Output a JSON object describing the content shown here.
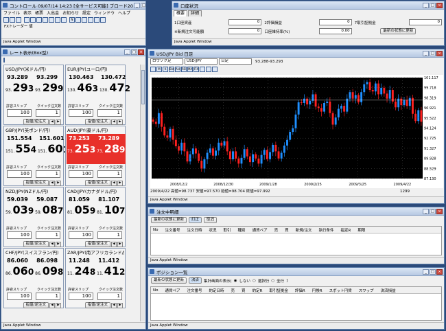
{
  "control": {
    "title": "コントロール 09/07/14 14:23 [全サービス可能] ブロード20",
    "menu": [
      "ファイル",
      "表示",
      "帳票",
      "入出金",
      "お知らせ",
      "設定",
      "ウィンドウ",
      "ヘルプ"
    ],
    "sub": "FXトレーダー 値",
    "status": "Java Applet Window"
  },
  "account": {
    "title": "口座状況",
    "tabs": [
      "概要",
      "詳細"
    ],
    "fields": [
      {
        "label": "1口座資産",
        "value": "0"
      },
      {
        "label": "2評価損益",
        "value": "0"
      },
      {
        "label": "7取引証拠金",
        "value": "0"
      },
      {
        "label": "※新規注文可能額",
        "value": "0"
      },
      {
        "label": "口座維持率(%)",
        "value": "0.00"
      }
    ],
    "refresh": "最新の状態に更新",
    "status": "Java Applet Window"
  },
  "rate": {
    "title": "レート表示(Box型)",
    "allowance_label": "許容スリップ",
    "qty_label": "クイック注文数",
    "order_btn": "指値/逆注文",
    "status": "Java Applet Window",
    "pairs": [
      {
        "name": "USD/JPY(米ドル/円)",
        "bid_small": "93.289",
        "ask_small": "93.299",
        "bid_pre": "93.",
        "bid_big": "29",
        "bid_tail": "3",
        "ask_pre": "93.",
        "ask_big": "29",
        "ask_tail": "9",
        "slip": "100",
        "qty": "1",
        "hl": false
      },
      {
        "name": "EUR/JPY(ユーロ/円)",
        "bid_small": "130.463",
        "ask_small": "130.472",
        "bid_pre": "130.",
        "bid_big": "46",
        "bid_tail": "3",
        "ask_pre": "130.",
        "ask_big": "47",
        "ask_tail": "2",
        "slip": "100",
        "qty": "1",
        "hl": false
      },
      {
        "name": "GBP/JPY(英ポンド/円)",
        "bid_small": "151.554",
        "ask_small": "151.601",
        "bid_pre": "151.",
        "bid_big": "55",
        "bid_tail": "4",
        "ask_pre": "151.",
        "ask_big": "60",
        "ask_tail": "1",
        "slip": "100",
        "qty": "1",
        "hl": false
      },
      {
        "name": "AUD/JPY(豪ドル/円)",
        "bid_small": "73.253",
        "ask_small": "73.289",
        "bid_pre": "73.",
        "bid_big": "25",
        "bid_tail": "3",
        "ask_pre": "73.",
        "ask_big": "28",
        "ask_tail": "9",
        "slip": "100",
        "qty": "1",
        "hl": true
      },
      {
        "name": "NZD/JPY(NZドル/円)",
        "bid_small": "59.039",
        "ask_small": "59.087",
        "bid_pre": "59.",
        "bid_big": "03",
        "bid_tail": "9",
        "ask_pre": "59.",
        "ask_big": "08",
        "ask_tail": "7",
        "slip": "100",
        "qty": "1",
        "hl": false
      },
      {
        "name": "CAD/JPY(カナダドル/円)",
        "bid_small": "81.059",
        "ask_small": "81.107",
        "bid_pre": "81.",
        "bid_big": "05",
        "bid_tail": "9",
        "ask_pre": "81.",
        "ask_big": "10",
        "ask_tail": "7",
        "slip": "100",
        "qty": "1",
        "hl": false
      },
      {
        "name": "CHF/JPY(スイスフラン/円)",
        "bid_small": "86.060",
        "ask_small": "86.098",
        "bid_pre": "86.",
        "bid_big": "06",
        "bid_tail": "0",
        "ask_pre": "86.",
        "ask_big": "09",
        "ask_tail": "8",
        "slip": "100",
        "qty": "1",
        "hl": false
      },
      {
        "name": "ZAR/JPY(南アフリカランド/円)",
        "bid_small": "11.248",
        "ask_small": "11.412",
        "bid_pre": "11.",
        "bid_big": "24",
        "bid_tail": "8",
        "ask_pre": "11.",
        "ask_big": "41",
        "ask_tail": "2",
        "slip": "100",
        "qty": "1",
        "hl": false
      }
    ]
  },
  "chart": {
    "title": "USD/JPY Bid 日足",
    "sel1": "ロウソク足",
    "sel2": "USD/JPY",
    "sel3": "日足",
    "range": "93.288-93.293",
    "tools": [
      "M",
      "K",
      "Bid",
      "Ask",
      "RSI",
      "MA",
      "FIX"
    ],
    "info": "2009/4/22 高値=98.737 安値=97.570 始値=98.704 終値=97.992",
    "bars": "1299",
    "status": "Java Applet Window",
    "x_labels": [
      "2008/12/2",
      "2008/12/30",
      "2009/1/28",
      "2009/2/25",
      "2009/3/25",
      "2009/4/22"
    ],
    "y_labels": [
      "101.117",
      "99.718",
      "98.319",
      "96.921",
      "95.522",
      "94.124",
      "92.725",
      "91.327",
      "89.928",
      "88.529",
      "87.130"
    ],
    "last_price": "97.992"
  },
  "chart_data": {
    "type": "candlestick",
    "x_ticks": [
      "2008/12/2",
      "2008/12/30",
      "2009/1/28",
      "2009/2/25",
      "2009/3/25",
      "2009/4/22"
    ],
    "ylim": [
      87.13,
      101.117
    ],
    "closes": [
      95.0,
      94.7,
      96.2,
      94.3,
      93.1,
      92.8,
      94.0,
      92.5,
      91.6,
      91.0,
      92.1,
      90.9,
      89.5,
      90.5,
      91.3,
      90.6,
      89.6,
      88.5,
      89.8,
      90.7,
      91.3,
      90.3,
      91.0,
      92.1,
      91.7,
      92.3,
      90.9,
      89.8,
      90.9,
      89.9,
      89.2,
      90.0,
      91.2,
      90.2,
      89.4,
      90.5,
      89.9,
      89.2,
      90.4,
      91.1,
      89.8,
      90.8,
      91.8,
      90.9,
      89.9,
      90.7,
      91.7,
      92.5,
      93.6,
      94.1,
      96.0,
      97.7,
      97.6,
      98.2,
      97.4,
      97.9,
      98.8,
      97.1,
      96.9,
      96.4,
      97.6,
      97.8,
      96.2,
      94.6,
      95.6,
      96.8,
      97.2,
      96.4,
      98.2,
      99.1,
      98.2,
      98.7,
      97.7,
      99.1,
      100.2,
      100.5,
      99.4,
      99.2,
      100.3,
      98.8,
      99.7,
      98.9,
      98.2,
      99.4,
      97.8,
      97.0,
      98.2,
      97.3,
      98.0,
      97.2,
      98.3,
      96.1,
      95.1,
      96.6,
      95.0
    ]
  },
  "orders": {
    "title": "注文中明細",
    "buttons": [
      "最新の状態に更新",
      "訂正",
      "取消"
    ],
    "columns": [
      "No",
      "注文番号",
      "注文日時",
      "状況",
      "取引",
      "種別",
      "通貨ペア",
      "売",
      "買",
      "新規/注文",
      "執行条件",
      "指定R",
      "期限"
    ],
    "status": "Java Applet Window"
  },
  "positions": {
    "title": "ポジション一覧",
    "buttons": [
      "最新の状態に更新",
      "決済"
    ],
    "agg_label": "集計画面の表示(",
    "radios": [
      "しない",
      "選択行",
      "全行"
    ],
    "columns": [
      "No",
      "通貨ペア",
      "注文番号",
      "約定日時",
      "売",
      "買",
      "約定R",
      "取引証拠金",
      "評価R",
      "円換R",
      "スポット円貨",
      "スワップ",
      "決済損益"
    ],
    "status": "Java Applet Window"
  }
}
